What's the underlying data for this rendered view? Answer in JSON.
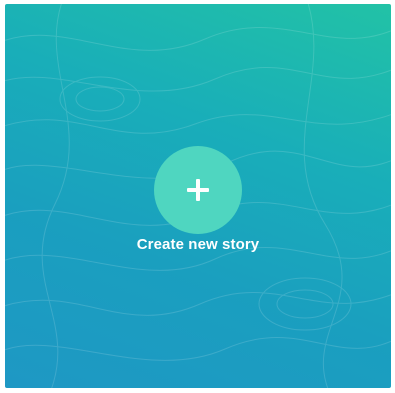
{
  "card": {
    "label": "Create new story",
    "icon": "plus-icon",
    "colors": {
      "gradient_top_right": "#22c2a6",
      "gradient_mid": "#19aeb9",
      "gradient_bottom_left": "#1e98c4",
      "circle": "#4fd6c0",
      "text": "#ffffff"
    }
  }
}
